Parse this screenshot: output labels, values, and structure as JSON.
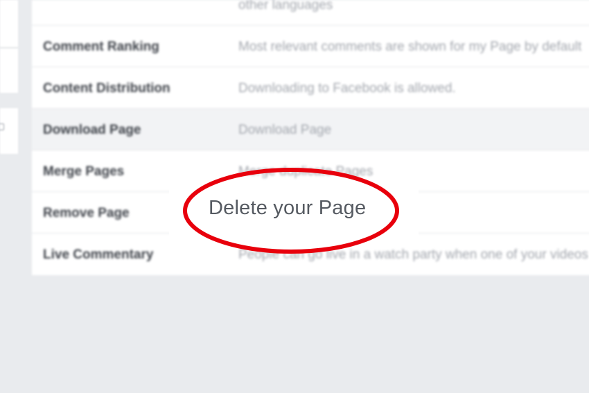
{
  "settings_rows": [
    {
      "label": "",
      "value": "other languages"
    },
    {
      "label": "Comment Ranking",
      "value": "Most relevant comments are shown for my Page by default"
    },
    {
      "label": "Content Distribution",
      "value": "Downloading to Facebook is allowed."
    },
    {
      "label": "Download Page",
      "value": "Download Page"
    },
    {
      "label": "Merge Pages",
      "value": "Merge duplicate Pages"
    },
    {
      "label": "Remove Page",
      "value": ""
    },
    {
      "label": "Live Commentary",
      "value": "People can go live in a watch party when one of your videos"
    }
  ],
  "callout": {
    "text": "Delete your Page",
    "ring_color": "#e8000c"
  },
  "colors": {
    "page_background": "#e9ebee",
    "panel_background": "#ffffff",
    "shaded_row": "#f2f3f5",
    "label_text": "#3f434a",
    "value_text": "#a3a7ae"
  }
}
